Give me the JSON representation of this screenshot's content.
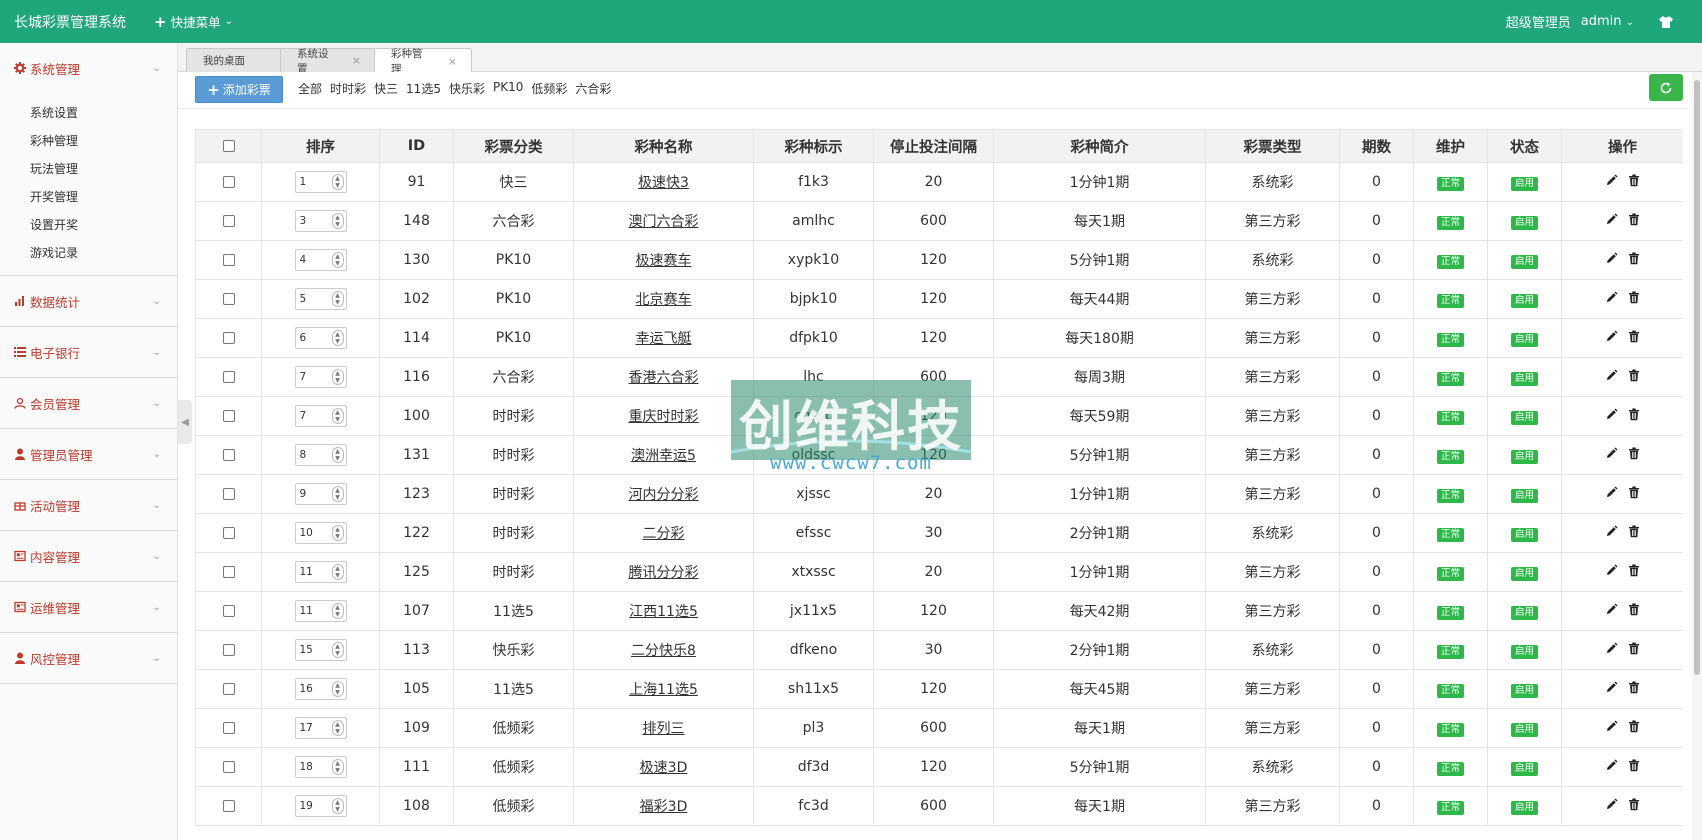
{
  "app": {
    "title": "长城彩票管理系统",
    "quick_menu": "快捷菜单",
    "user_role": "超级管理员",
    "username": "admin"
  },
  "sidebar": {
    "groups": [
      {
        "label": "系统管理",
        "icon": "gear-icon",
        "expanded": true,
        "items": [
          "系统设置",
          "彩种管理",
          "玩法管理",
          "开奖管理",
          "设置开奖",
          "游戏记录"
        ]
      },
      {
        "label": "数据统计",
        "icon": "bar-chart-icon"
      },
      {
        "label": "电子银行",
        "icon": "list-icon"
      },
      {
        "label": "会员管理",
        "icon": "user-icon"
      },
      {
        "label": "管理员管理",
        "icon": "user-solid-icon"
      },
      {
        "label": "活动管理",
        "icon": "gift-icon"
      },
      {
        "label": "内容管理",
        "icon": "newspaper-icon"
      },
      {
        "label": "运维管理",
        "icon": "newspaper-icon"
      },
      {
        "label": "风控管理",
        "icon": "user-solid-icon"
      }
    ]
  },
  "tabs": [
    {
      "label": "我的桌面",
      "closable": false
    },
    {
      "label": "系统设置",
      "closable": true
    },
    {
      "label": "彩种管理",
      "closable": true,
      "active": true
    }
  ],
  "toolbar": {
    "add_label": "添加彩票",
    "filters": [
      "全部",
      "时时彩",
      "快三",
      "11选5",
      "快乐彩",
      "PK10",
      "低频彩",
      "六合彩"
    ]
  },
  "table": {
    "headers": [
      "",
      "排序",
      "ID",
      "彩票分类",
      "彩种名称",
      "彩种标示",
      "停止投注间隔",
      "彩种简介",
      "彩票类型",
      "期数",
      "维护",
      "状态",
      "操作"
    ],
    "rows": [
      {
        "sort": "1",
        "id": "91",
        "category": "快三",
        "name": "极速快3",
        "code": "f1k3",
        "interval": "20",
        "intro": "1分钟1期",
        "type": "系统彩",
        "periods": "0",
        "maint": "正常",
        "status": "启用"
      },
      {
        "sort": "3",
        "id": "148",
        "category": "六合彩",
        "name": "澳门六合彩",
        "code": "amlhc",
        "interval": "600",
        "intro": "每天1期",
        "type": "第三方彩",
        "periods": "0",
        "maint": "正常",
        "status": "启用"
      },
      {
        "sort": "4",
        "id": "130",
        "category": "PK10",
        "name": "极速赛车",
        "code": "xypk10",
        "interval": "120",
        "intro": "5分钟1期",
        "type": "系统彩",
        "periods": "0",
        "maint": "正常",
        "status": "启用"
      },
      {
        "sort": "5",
        "id": "102",
        "category": "PK10",
        "name": "北京赛车",
        "code": "bjpk10",
        "interval": "120",
        "intro": "每天44期",
        "type": "第三方彩",
        "periods": "0",
        "maint": "正常",
        "status": "启用"
      },
      {
        "sort": "6",
        "id": "114",
        "category": "PK10",
        "name": "幸运飞艇",
        "code": "dfpk10",
        "interval": "120",
        "intro": "每天180期",
        "type": "第三方彩",
        "periods": "0",
        "maint": "正常",
        "status": "启用"
      },
      {
        "sort": "7",
        "id": "116",
        "category": "六合彩",
        "name": "香港六合彩",
        "code": "lhc",
        "interval": "600",
        "intro": "每周3期",
        "type": "第三方彩",
        "periods": "0",
        "maint": "正常",
        "status": "启用"
      },
      {
        "sort": "7",
        "id": "100",
        "category": "时时彩",
        "name": "重庆时时彩",
        "code": "cqssc",
        "interval": "120",
        "intro": "每天59期",
        "type": "第三方彩",
        "periods": "0",
        "maint": "正常",
        "status": "启用"
      },
      {
        "sort": "8",
        "id": "131",
        "category": "时时彩",
        "name": "澳洲幸运5",
        "code": "oldssc",
        "interval": "120",
        "intro": "5分钟1期",
        "type": "第三方彩",
        "periods": "0",
        "maint": "正常",
        "status": "启用"
      },
      {
        "sort": "9",
        "id": "123",
        "category": "时时彩",
        "name": "河内分分彩",
        "code": "xjssc",
        "interval": "20",
        "intro": "1分钟1期",
        "type": "第三方彩",
        "periods": "0",
        "maint": "正常",
        "status": "启用"
      },
      {
        "sort": "10",
        "id": "122",
        "category": "时时彩",
        "name": "二分彩",
        "code": "efssc",
        "interval": "30",
        "intro": "2分钟1期",
        "type": "系统彩",
        "periods": "0",
        "maint": "正常",
        "status": "启用"
      },
      {
        "sort": "11",
        "id": "125",
        "category": "时时彩",
        "name": "腾讯分分彩",
        "code": "xtxssc",
        "interval": "20",
        "intro": "1分钟1期",
        "type": "第三方彩",
        "periods": "0",
        "maint": "正常",
        "status": "启用"
      },
      {
        "sort": "11",
        "id": "107",
        "category": "11选5",
        "name": "江西11选5",
        "code": "jx11x5",
        "interval": "120",
        "intro": "每天42期",
        "type": "第三方彩",
        "periods": "0",
        "maint": "正常",
        "status": "启用"
      },
      {
        "sort": "15",
        "id": "113",
        "category": "快乐彩",
        "name": "二分快乐8",
        "code": "dfkeno",
        "interval": "30",
        "intro": "2分钟1期",
        "type": "系统彩",
        "periods": "0",
        "maint": "正常",
        "status": "启用"
      },
      {
        "sort": "16",
        "id": "105",
        "category": "11选5",
        "name": "上海11选5",
        "code": "sh11x5",
        "interval": "120",
        "intro": "每天45期",
        "type": "第三方彩",
        "periods": "0",
        "maint": "正常",
        "status": "启用"
      },
      {
        "sort": "17",
        "id": "109",
        "category": "低频彩",
        "name": "排列三",
        "code": "pl3",
        "interval": "600",
        "intro": "每天1期",
        "type": "第三方彩",
        "periods": "0",
        "maint": "正常",
        "status": "启用"
      },
      {
        "sort": "18",
        "id": "111",
        "category": "低频彩",
        "name": "极速3D",
        "code": "df3d",
        "interval": "120",
        "intro": "5分钟1期",
        "type": "系统彩",
        "periods": "0",
        "maint": "正常",
        "status": "启用"
      },
      {
        "sort": "19",
        "id": "108",
        "category": "低频彩",
        "name": "福彩3D",
        "code": "fc3d",
        "interval": "600",
        "intro": "每天1期",
        "type": "第三方彩",
        "periods": "0",
        "maint": "正常",
        "status": "启用"
      }
    ]
  },
  "watermark": {
    "text": "创维科技",
    "url": "www.cwcw7.com"
  },
  "colors": {
    "topbar": "#1fa67a",
    "sidebar_text": "#c0392b",
    "add_button": "#5b9bd5",
    "badge": "#2eb84a",
    "refresh": "#39b54a"
  }
}
